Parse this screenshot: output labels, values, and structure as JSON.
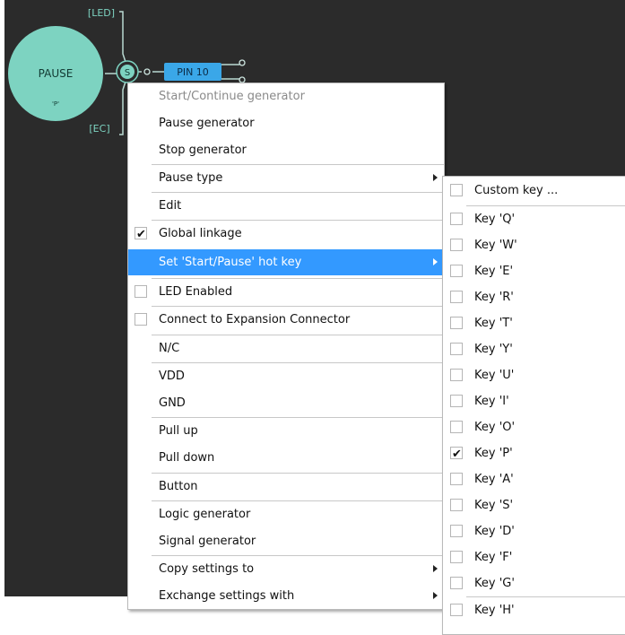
{
  "diagram": {
    "pause_node_label": "PAUSE",
    "pause_node_key": "'P'",
    "led_tag": "[LED]",
    "ec_tag": "[EC]",
    "s_badge": "S",
    "pin_label": "PIN 10",
    "colors": {
      "canvas": "#2b2b2b",
      "node_fill": "#7dd3c1",
      "wire": "#b9d9d2",
      "pin_fill": "#3aa7e8",
      "tag_text": "#7dd3c1"
    }
  },
  "main_menu": {
    "items": [
      {
        "label": "Start/Continue generator",
        "disabled": true
      },
      {
        "label": "Pause generator"
      },
      {
        "label": "Stop generator"
      },
      {
        "label": "Pause type",
        "submenu": true
      },
      {
        "label": "Edit"
      },
      {
        "label": "Global linkage",
        "checked": true
      },
      {
        "label": "Set 'Start/Pause' hot key",
        "submenu": true,
        "highlighted": true
      },
      {
        "label": "LED Enabled",
        "checkbox": true,
        "checked": false
      },
      {
        "label": "Connect to Expansion Connector",
        "checkbox": true,
        "checked": false
      },
      {
        "label": "N/C"
      },
      {
        "label": "VDD"
      },
      {
        "label": "GND"
      },
      {
        "label": "Pull up"
      },
      {
        "label": "Pull down"
      },
      {
        "label": "Button"
      },
      {
        "label": "Logic generator"
      },
      {
        "label": "Signal generator"
      },
      {
        "label": "Copy settings to",
        "submenu": true
      },
      {
        "label": "Exchange settings with",
        "submenu": true
      }
    ]
  },
  "hotkey_menu": {
    "items": [
      {
        "label": "Custom key ...",
        "checked": false
      },
      {
        "label": "Key 'Q'",
        "checked": false
      },
      {
        "label": "Key 'W'",
        "checked": false
      },
      {
        "label": "Key 'E'",
        "checked": false
      },
      {
        "label": "Key 'R'",
        "checked": false
      },
      {
        "label": "Key 'T'",
        "checked": false
      },
      {
        "label": "Key 'Y'",
        "checked": false
      },
      {
        "label": "Key 'U'",
        "checked": false
      },
      {
        "label": "Key 'I'",
        "checked": false
      },
      {
        "label": "Key 'O'",
        "checked": false
      },
      {
        "label": "Key 'P'",
        "checked": true
      },
      {
        "label": "Key 'A'",
        "checked": false
      },
      {
        "label": "Key 'S'",
        "checked": false
      },
      {
        "label": "Key 'D'",
        "checked": false
      },
      {
        "label": "Key 'F'",
        "checked": false
      },
      {
        "label": "Key 'G'",
        "checked": false
      },
      {
        "label": "Key 'H'",
        "checked": false
      }
    ]
  },
  "checkmark": "✔"
}
